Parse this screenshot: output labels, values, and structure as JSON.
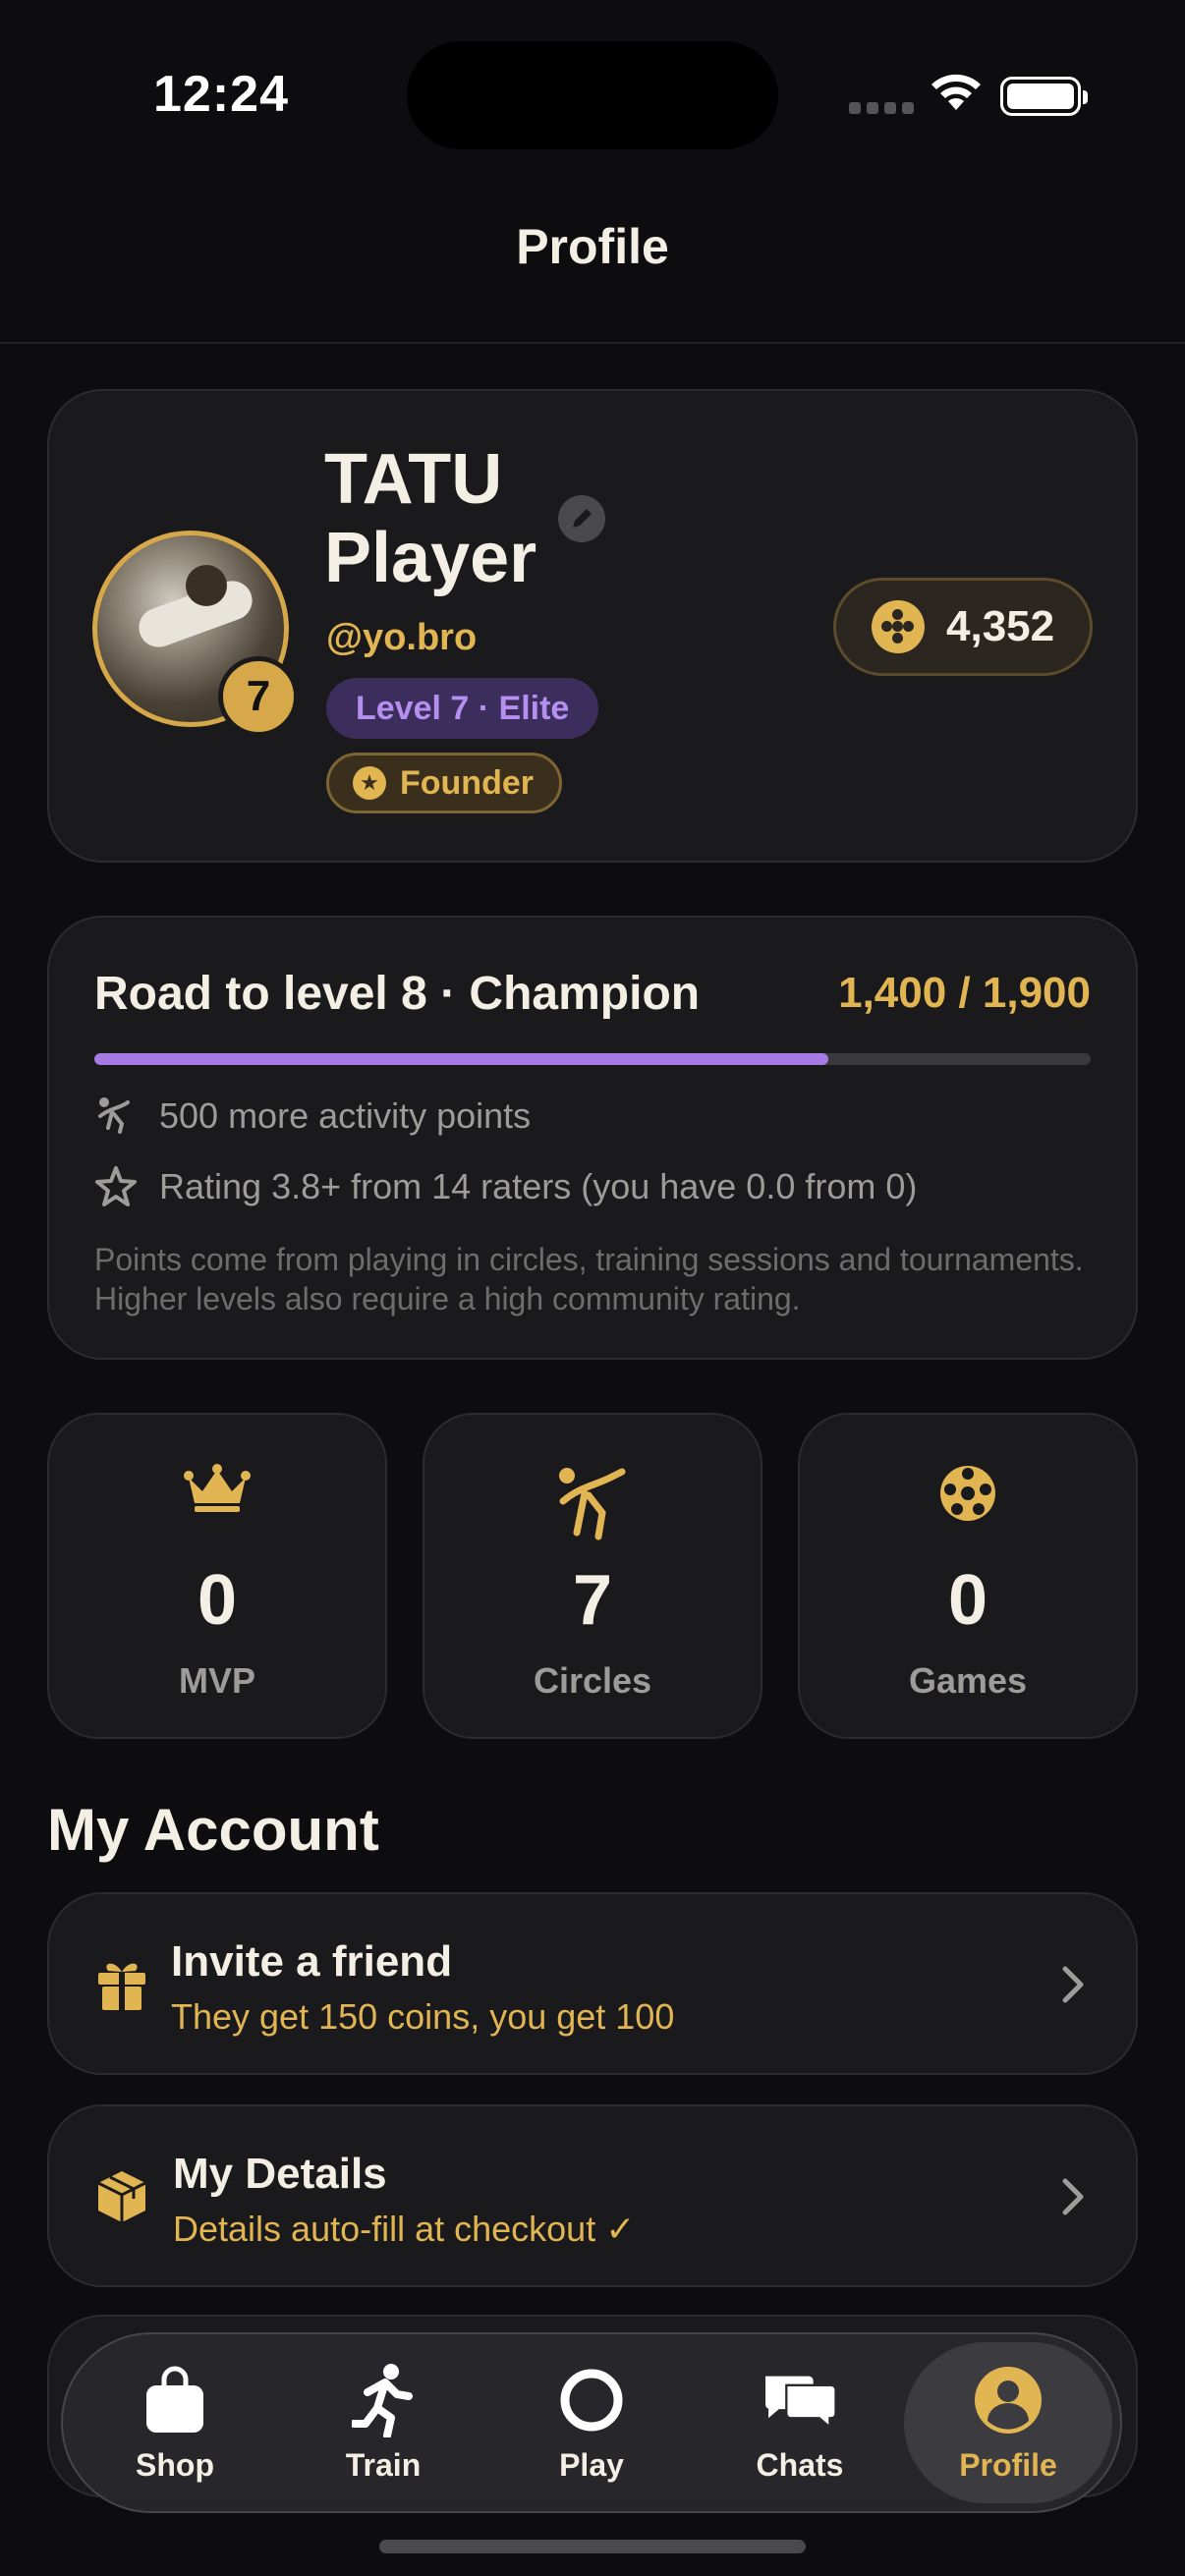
{
  "status_bar": {
    "time": "12:24"
  },
  "header": {
    "title": "Profile"
  },
  "profile": {
    "name": "TATU Player",
    "username": "@yo.bro",
    "level_badge": "7",
    "level_pill": "Level 7 · Elite",
    "founder_label": "Founder",
    "coins": "4,352"
  },
  "progress": {
    "title": "Road to level 8 · Champion",
    "value_text": "1,400 / 1,900",
    "fraction": 0.737,
    "requirement_points": "500 more activity points",
    "requirement_rating": "Rating 3.8+ from 14 raters (you have 0.0 from 0)",
    "note": "Points come from playing in circles, training sessions and tournaments. Higher levels also require a high community rating."
  },
  "stats": [
    {
      "value": "0",
      "label": "MVP",
      "icon": "crown-icon"
    },
    {
      "value": "7",
      "label": "Circles",
      "icon": "kick-icon"
    },
    {
      "value": "0",
      "label": "Games",
      "icon": "soccer-ball-icon"
    }
  ],
  "account": {
    "section_title": "My Account",
    "items": [
      {
        "title": "Invite a friend",
        "subtitle": "They get 150 coins, you get 100",
        "icon": "gift-icon"
      },
      {
        "title": "My Details",
        "subtitle": "Details auto-fill at checkout ✓",
        "icon": "box-icon"
      }
    ]
  },
  "tab_bar": {
    "tabs": [
      {
        "label": "Shop",
        "icon": "shopping-bag-icon"
      },
      {
        "label": "Train",
        "icon": "running-icon"
      },
      {
        "label": "Play",
        "icon": "ring-icon"
      },
      {
        "label": "Chats",
        "icon": "chat-bubbles-icon"
      },
      {
        "label": "Profile",
        "icon": "person-icon",
        "active": true
      }
    ]
  },
  "colors": {
    "accent_gold": "#e2b553",
    "accent_purple": "#a77be6",
    "background": "#0d0d0f",
    "card": "#1a1a1d"
  }
}
